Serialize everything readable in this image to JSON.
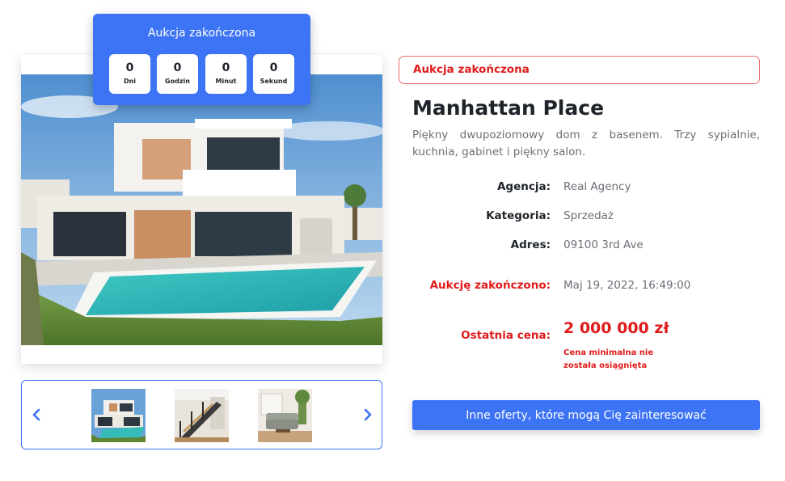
{
  "countdown": {
    "title": "Aukcja zakończona",
    "units": [
      {
        "value": "0",
        "label": "Dni"
      },
      {
        "value": "0",
        "label": "Godzin"
      },
      {
        "value": "0",
        "label": "Minut"
      },
      {
        "value": "0",
        "label": "Sekund"
      }
    ]
  },
  "gallery": {
    "main_image": "modern-villa-with-pool",
    "thumbnails": [
      "villa-exterior-pool",
      "interior-staircase",
      "living-room-sofa"
    ],
    "prev_icon": "chevron-left-icon",
    "next_icon": "chevron-right-icon"
  },
  "listing": {
    "status": "Aukcja zakończona",
    "title": "Manhattan Place",
    "description": "Piękny dwupoziomowy dom z basenem. Trzy sypialnie, kuchnia, gabinet i piękny salon.",
    "details": [
      {
        "label": "Agencja:",
        "value": "Real Agency"
      },
      {
        "label": "Kategoria:",
        "value": "Sprzedaż"
      },
      {
        "label": "Adres:",
        "value": "09100 3rd Ave"
      }
    ],
    "ended_label": "Aukcję zakończono:",
    "ended_value": "Maj 19, 2022, 16:49:00",
    "price_label": "Ostatnia cena:",
    "price_value": "2 000 000 zł",
    "price_note": "Cena minimalna nie została osiągnięta",
    "cta_label": "Inne oferty, które mogą Cię zainteresować"
  },
  "colors": {
    "accent": "#3d74f5",
    "alert": "#e01b1b",
    "text": "#1f242b",
    "muted": "#6b6f76"
  }
}
